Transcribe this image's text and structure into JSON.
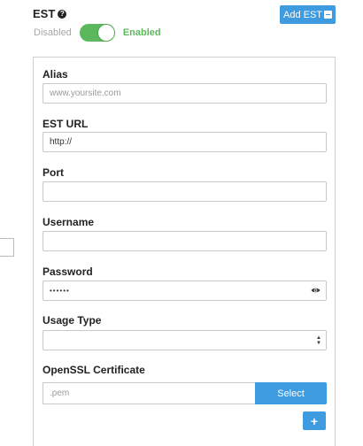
{
  "header": {
    "title": "EST",
    "help_icon": "question-circle-icon",
    "add_button_label": "Add EST",
    "add_button_icon": "minus-square-icon"
  },
  "toggle": {
    "off_label": "Disabled",
    "on_label": "Enabled",
    "state": "on"
  },
  "form": {
    "alias": {
      "label": "Alias",
      "placeholder": "www.yoursite.com",
      "value": ""
    },
    "est_url": {
      "label": "EST URL",
      "value": "http://"
    },
    "port": {
      "label": "Port",
      "value": ""
    },
    "username": {
      "label": "Username",
      "value": ""
    },
    "password": {
      "label": "Password",
      "masked_value": "••••••",
      "icon": "eye-icon"
    },
    "usage_type": {
      "label": "Usage Type",
      "selected": ""
    },
    "openssl_certificate": {
      "label": "OpenSSL Certificate",
      "placeholder": ".pem",
      "select_button_label": "Select"
    },
    "add_row_button_label": "+"
  },
  "colors": {
    "primary": "#3e9be0",
    "toggle_on": "#5cb85c",
    "muted": "#a8a8a8"
  }
}
